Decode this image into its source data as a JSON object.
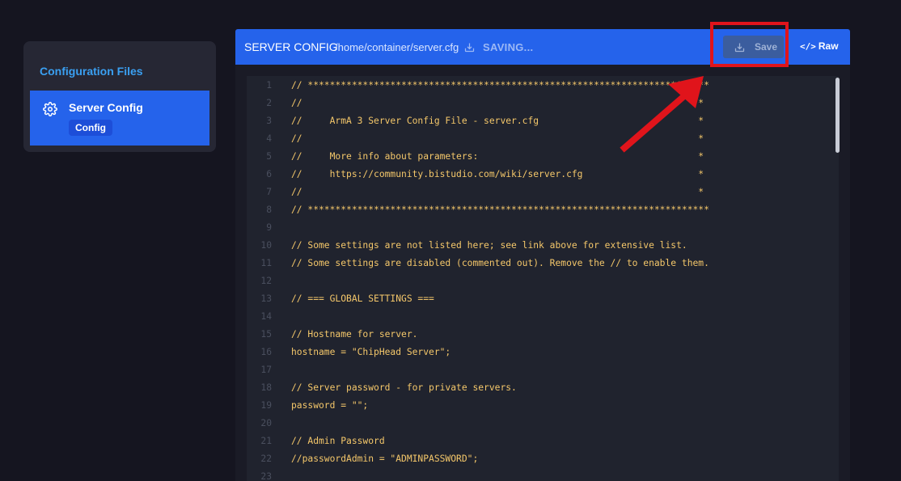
{
  "sidebar": {
    "title": "Configuration Files",
    "items": [
      {
        "label": "Server Config",
        "badge": "Config",
        "icon": "gear-icon"
      }
    ]
  },
  "header": {
    "title": "SERVER CONFIG",
    "path": "/home/container/server.cfg",
    "status": "SAVING...",
    "save_label": "Save",
    "raw_label": "Raw"
  },
  "editor": {
    "lines": [
      {
        "n": "1",
        "text": "// *************************************************************************"
      },
      {
        "n": "2",
        "text": "//                                                                        *"
      },
      {
        "n": "3",
        "text": "//     ArmA 3 Server Config File - server.cfg                             *"
      },
      {
        "n": "4",
        "text": "//                                                                        *"
      },
      {
        "n": "5",
        "text": "//     More info about parameters:                                        *"
      },
      {
        "n": "6",
        "text": "//     https://community.bistudio.com/wiki/server.cfg                     *"
      },
      {
        "n": "7",
        "text": "//                                                                        *"
      },
      {
        "n": "8",
        "text": "// *************************************************************************"
      },
      {
        "n": "9",
        "text": ""
      },
      {
        "n": "10",
        "text": "// Some settings are not listed here; see link above for extensive list."
      },
      {
        "n": "11",
        "text": "// Some settings are disabled (commented out). Remove the // to enable them."
      },
      {
        "n": "12",
        "text": ""
      },
      {
        "n": "13",
        "text": "// === GLOBAL SETTINGS ==="
      },
      {
        "n": "14",
        "text": ""
      },
      {
        "n": "15",
        "text": "// Hostname for server."
      },
      {
        "n": "16",
        "text": "hostname = \"ChipHead Server\";"
      },
      {
        "n": "17",
        "text": ""
      },
      {
        "n": "18",
        "text": "// Server password - for private servers."
      },
      {
        "n": "19",
        "text": "password = \"\";"
      },
      {
        "n": "20",
        "text": ""
      },
      {
        "n": "21",
        "text": "// Admin Password"
      },
      {
        "n": "22",
        "text": "//passwordAdmin = \"ADMINPASSWORD\";"
      },
      {
        "n": "23",
        "text": ""
      }
    ]
  },
  "colors": {
    "accent": "#2563eb",
    "highlight": "#e0141b",
    "code": "#f4c76a"
  }
}
